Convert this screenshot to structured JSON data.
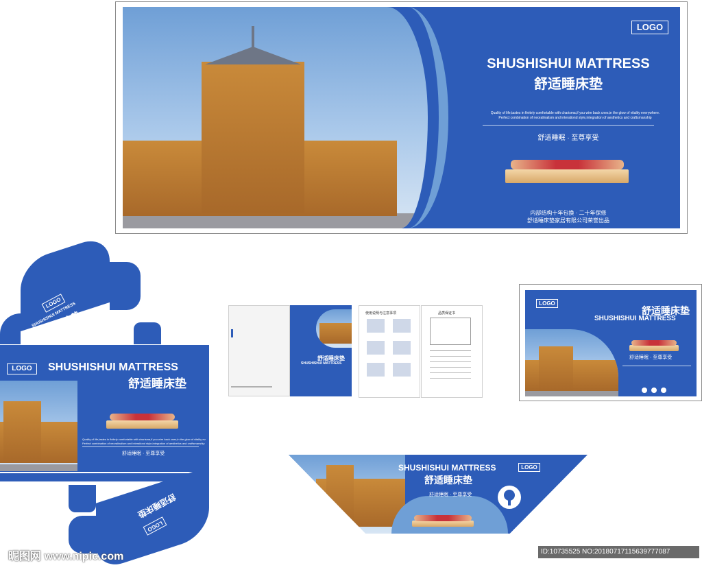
{
  "brand": {
    "logo": "LOGO",
    "name_en": "SHUSHISHUI MATTRESS",
    "name_cn": "舒适睡床垫",
    "slogan": "舒适睡眠 · 至尊享受",
    "tagline_line1": "Quality of life,tastes in finitely comfortable with charisma,if you wire back cnes,in the glow of vitality everywhere.",
    "tagline_line2": "Perfect combination of neoralinalism and interationd style,integration of aesthetics and craftsmanship",
    "warranty": "内部结构十年包换 · 二十年保修",
    "producer": "舒适睡床垫家居有限公司荣誉出品"
  },
  "brochure": {
    "inner_title": "使用说明与注意事项",
    "certificate_title": "品质保证书"
  },
  "watermark": {
    "site": "昵图网 www.nipic.com",
    "id": "ID:10735525 NO:20180717115639777087"
  },
  "colors": {
    "primary": "#2d5cb8",
    "light": "#6f9fd6"
  }
}
